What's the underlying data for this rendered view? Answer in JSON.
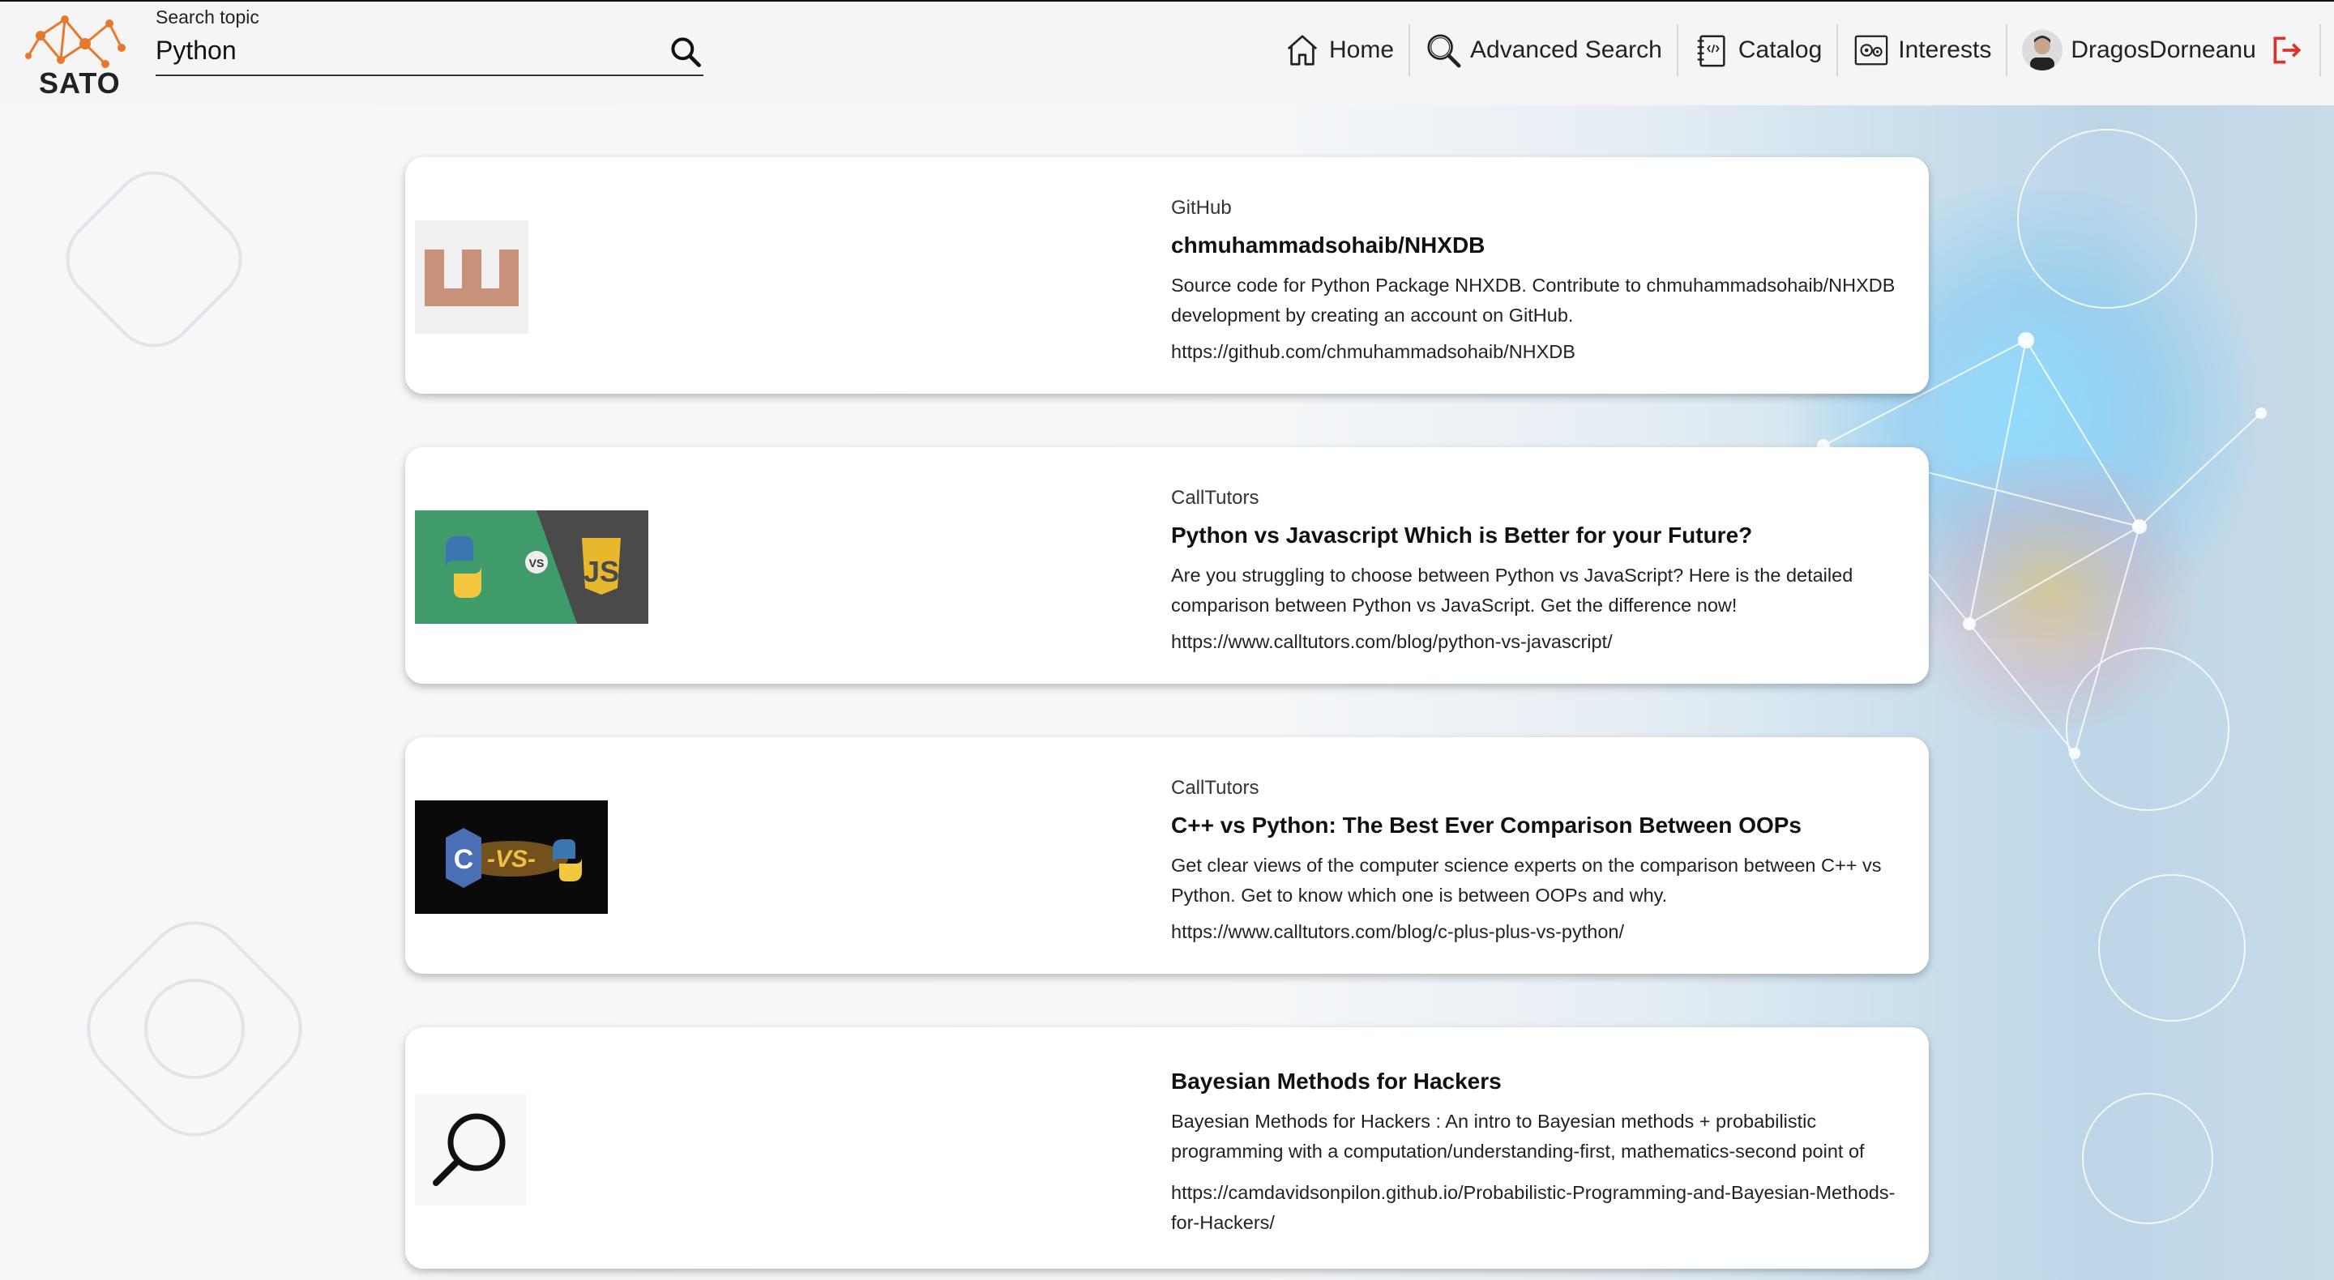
{
  "header": {
    "logo_text": "SATO",
    "search": {
      "label": "Search topic",
      "value": "Python",
      "placeholder": ""
    },
    "nav": {
      "home": "Home",
      "advanced_search": "Advanced Search",
      "catalog": "Catalog",
      "interests": "Interests",
      "username": "DragosDorneanu"
    }
  },
  "results": [
    {
      "source": "GitHub",
      "title": "chmuhammadsohaib/NHXDB",
      "description": "Source code for Python Package NHXDB. Contribute to chmuhammadsohaib/NHXDB development by creating an account on GitHub.",
      "url": "https://github.com/chmuhammadsohaib/NHXDB"
    },
    {
      "source": "CallTutors",
      "title": "Python vs Javascript Which is Better for your Future?",
      "description": "Are you struggling to choose between Python vs JavaScript? Here is the detailed comparison between Python vs JavaScript. Get the difference now!",
      "url": "https://www.calltutors.com/blog/python-vs-javascript/"
    },
    {
      "source": "CallTutors",
      "title": "C++ vs Python: The Best Ever Comparison Between OOPs",
      "description": "Get clear views of the computer science experts on the comparison between C++ vs Python. Get to know which one is between OOPs and why.",
      "url": "https://www.calltutors.com/blog/c-plus-plus-vs-python/"
    },
    {
      "source": "",
      "title": "Bayesian Methods for Hackers",
      "description": "Bayesian Methods for Hackers : An intro to Bayesian methods + probabilistic programming with a computation/understanding-first, mathematics-second point of",
      "url": "https://camdavidsonpilon.github.io/Probabilistic-Programming-and-Bayesian-Methods-for-Hackers/"
    }
  ],
  "thumbnails": {
    "vs_text": "VS",
    "js_text": "JS",
    "c_text": "C",
    "vs_slash": "-VS-"
  },
  "colors": {
    "accent_orange": "#e8792c",
    "logout_red": "#e0302a",
    "identicon": "#c8917a"
  }
}
